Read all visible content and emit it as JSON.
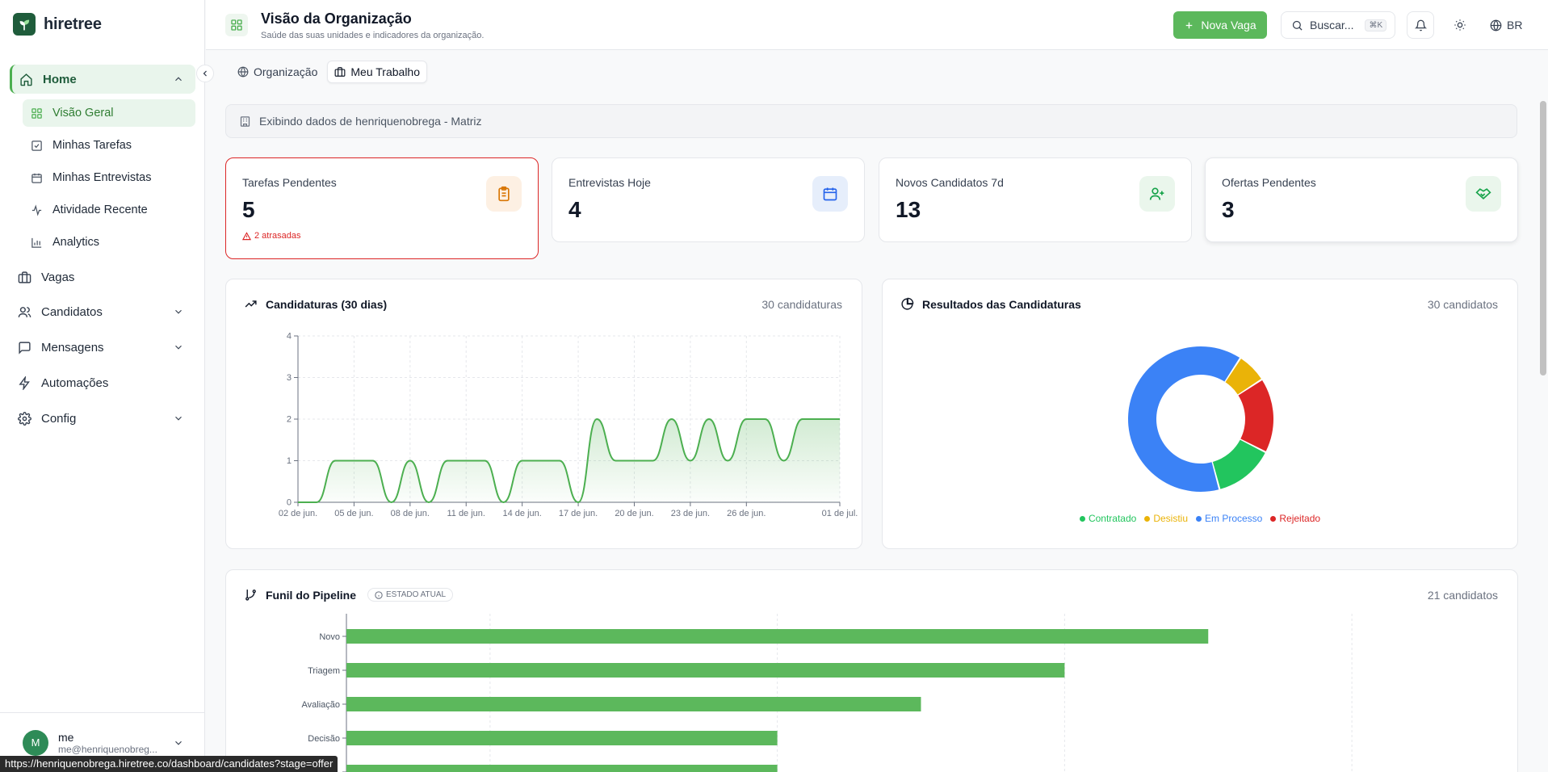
{
  "brand": {
    "name": "hiretree"
  },
  "sidebar": {
    "home": {
      "label": "Home"
    },
    "home_items": [
      {
        "label": "Visão Geral"
      },
      {
        "label": "Minhas Tarefas"
      },
      {
        "label": "Minhas Entrevistas"
      },
      {
        "label": "Atividade Recente"
      },
      {
        "label": "Analytics"
      }
    ],
    "items": [
      {
        "label": "Vagas"
      },
      {
        "label": "Candidatos"
      },
      {
        "label": "Mensagens"
      },
      {
        "label": "Automações"
      },
      {
        "label": "Config"
      }
    ],
    "user": {
      "initial": "M",
      "name": "me",
      "email": "me@henriquenobreg..."
    }
  },
  "status_url": "https://henriquenobrega.hiretree.co/dashboard/candidates?stage=offer",
  "header": {
    "title": "Visão da Organização",
    "subtitle": "Saúde das suas unidades e indicadores da organização.",
    "new_button": "Nova Vaga",
    "search_placeholder": "Buscar...",
    "search_shortcut": "⌘K",
    "language": "BR"
  },
  "tabs": [
    {
      "label": "Organização"
    },
    {
      "label": "Meu Trabalho"
    }
  ],
  "info_text": "Exibindo dados de henriquenobrega - Matriz",
  "kpis": [
    {
      "label": "Tarefas Pendentes",
      "value": "5",
      "alert": "2 atrasadas",
      "color": "#d97706"
    },
    {
      "label": "Entrevistas Hoje",
      "value": "4",
      "color": "#2563eb"
    },
    {
      "label": "Novos Candidatos 7d",
      "value": "13",
      "color": "#16a34a"
    },
    {
      "label": "Ofertas Pendentes",
      "value": "3",
      "color": "#16a34a"
    }
  ],
  "applications_card": {
    "title": "Candidaturas (30 dias)",
    "count": "30 candidaturas"
  },
  "results_card": {
    "title": "Resultados das Candidaturas",
    "count": "30 candidatos"
  },
  "pipeline_card": {
    "title": "Funil do Pipeline",
    "badge": "ESTADO ATUAL",
    "count": "21 candidatos"
  },
  "chart_data": [
    {
      "type": "area",
      "y_ticks": [
        "0",
        "1",
        "2",
        "3",
        "4"
      ],
      "ylim": [
        0,
        4
      ],
      "x_ticks": [
        "02 de jun.",
        "05 de jun.",
        "08 de jun.",
        "11 de jun.",
        "14 de jun.",
        "17 de jun.",
        "20 de jun.",
        "23 de jun.",
        "26 de jun.",
        "01 de jul."
      ],
      "x_tick_index": [
        0,
        3,
        6,
        9,
        12,
        15,
        18,
        21,
        24,
        29
      ],
      "values": [
        0,
        0,
        1,
        1,
        1,
        0,
        1,
        0,
        1,
        1,
        1,
        0,
        1,
        1,
        1,
        0,
        2,
        1,
        1,
        1,
        2,
        1,
        2,
        1,
        2,
        2,
        1,
        2,
        2,
        2
      ],
      "color": "#4caf50",
      "grid": true
    },
    {
      "type": "pie",
      "labels": [
        "Contratado",
        "Desistiu",
        "Em Processo",
        "Rejeitado"
      ],
      "values": [
        4,
        2,
        19,
        5
      ],
      "colors": [
        "#22c55e",
        "#eab308",
        "#3b82f6",
        "#dc2626"
      ],
      "legend": "bottom"
    },
    {
      "type": "bar",
      "orientation": "horizontal",
      "categories": [
        "Novo",
        "Triagem",
        "Avaliação",
        "Decisão",
        ""
      ],
      "values": [
        6,
        5,
        4,
        3,
        3
      ],
      "xlim": [
        0,
        8
      ],
      "color": "#5cb85c",
      "grid": true
    }
  ]
}
